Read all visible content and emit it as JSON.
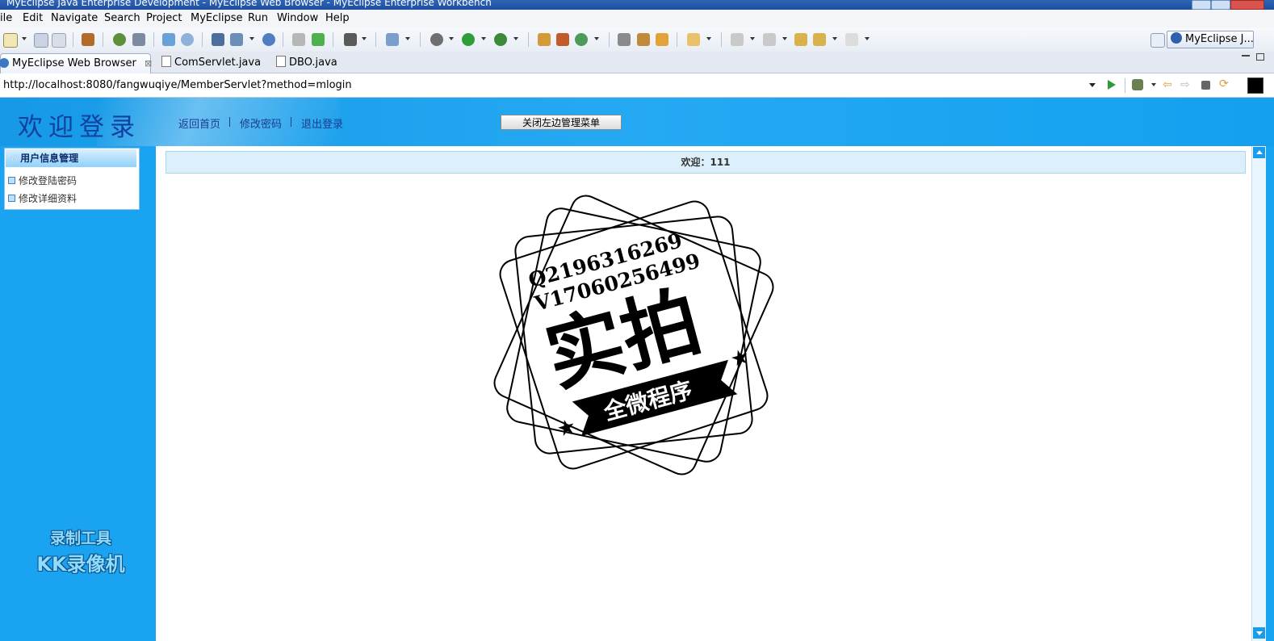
{
  "window": {
    "title": "MyEclipse Java Enterprise Development - MyEclipse Web Browser - MyEclipse Enterprise Workbench"
  },
  "menu": [
    "ile",
    "Edit",
    "Navigate",
    "Search",
    "Project",
    "MyEclipse",
    "Run",
    "Window",
    "Help"
  ],
  "toolbar": {
    "perspective_label": "MyEclipse J..."
  },
  "tabs": [
    {
      "label": "MyEclipse Web Browser",
      "active": true
    },
    {
      "label": "ComServlet.java",
      "active": false
    },
    {
      "label": "DBO.java",
      "active": false
    }
  ],
  "browser": {
    "url": "http://localhost:8080/fangwuqiye/MemberServlet?method=mlogin"
  },
  "site": {
    "header_title": "欢迎登录",
    "links": [
      "返回首页",
      "修改密码",
      "退出登录"
    ],
    "close_menu_button": "关闭左边管理菜单",
    "left_menu": {
      "title": "用户信息管理",
      "items": [
        "修改登陆密码",
        "修改详细资料"
      ]
    },
    "welcome_text": "欢迎：111"
  },
  "watermark": {
    "recorder_line1": "录制工具",
    "recorder_line2": "KK录像机",
    "stamp_line1": "Q2196316269",
    "stamp_line2": "V17060256499",
    "stamp_main": "实拍",
    "stamp_banner": "全微程序"
  },
  "colors": {
    "page_blue": "#1aa3f0",
    "title_blue": "#10419e",
    "welcome_bar": "#dbf0fb"
  }
}
